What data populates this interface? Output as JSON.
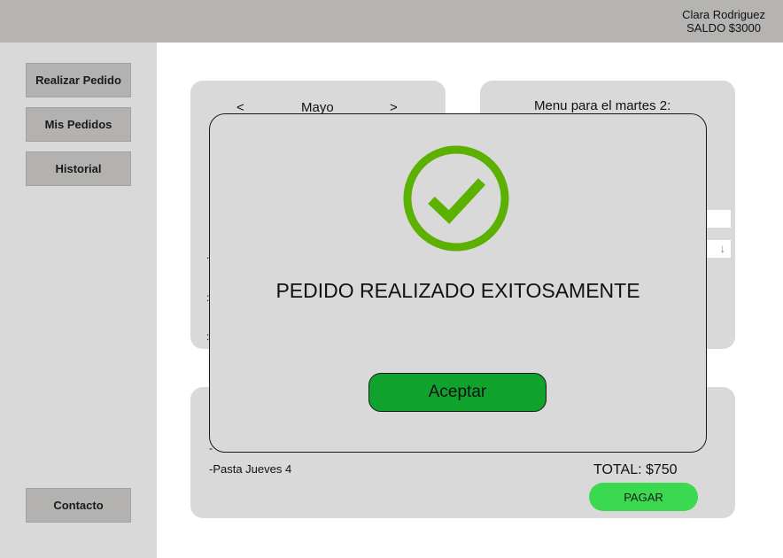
{
  "header": {
    "user_name": "Clara Rodriguez",
    "balance": "SALDO $3000"
  },
  "sidebar": {
    "items": [
      {
        "label": "Realizar Pedido"
      },
      {
        "label": "Mis Pedidos"
      },
      {
        "label": "Historial"
      }
    ],
    "contact_label": "Contacto"
  },
  "calendar": {
    "prev": "<",
    "month": "Mayo",
    "next": ">"
  },
  "menu_panel": {
    "title": "Menu para el martes 2:",
    "dropdown_icon": "chevron-down-icon"
  },
  "order_panel": {
    "items": [
      "-Pasta Jueves 4"
    ],
    "total": "TOTAL: $750",
    "pay_label": "PAGAR"
  },
  "modal": {
    "icon": "check-circle-icon",
    "message": "PEDIDO REALIZADO EXITOSAMENTE",
    "accept_label": "Aceptar"
  },
  "colors": {
    "topbar": "#b5b4b2",
    "sidebar": "#d9d9d9",
    "success_green": "#5bb000",
    "accept_button": "#0fa32d",
    "pay_button": "#3bd94f"
  }
}
